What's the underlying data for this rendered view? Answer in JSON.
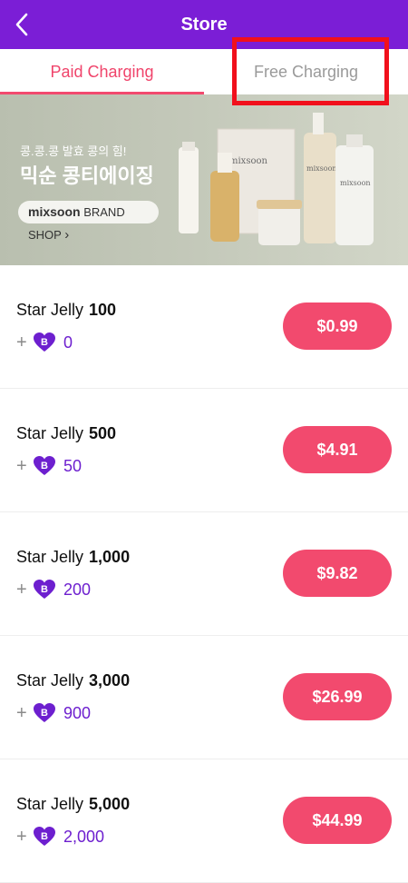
{
  "header": {
    "title": "Store"
  },
  "tabs": [
    {
      "label": "Paid Charging"
    },
    {
      "label": "Free Charging"
    }
  ],
  "banner": {
    "subtitle": "콩.콩.콩 발효 콩의 힘!",
    "title": "믹순 콩티에이징",
    "brand_button": {
      "brand": "mixsoon",
      "text": "BRAND SHOP"
    },
    "product_label": "mixsoon"
  },
  "colors": {
    "header": "#7b1ed6",
    "accent": "#f24a6e",
    "bonus": "#6d1fcf",
    "highlight": "#f1101c"
  },
  "items": [
    {
      "name": "Star Jelly",
      "amount": "100",
      "plus": "+",
      "badge": "B",
      "bonus": "0",
      "price": "$0.99"
    },
    {
      "name": "Star Jelly",
      "amount": "500",
      "plus": "+",
      "badge": "B",
      "bonus": "50",
      "price": "$4.91"
    },
    {
      "name": "Star Jelly",
      "amount": "1,000",
      "plus": "+",
      "badge": "B",
      "bonus": "200",
      "price": "$9.82"
    },
    {
      "name": "Star Jelly",
      "amount": "3,000",
      "plus": "+",
      "badge": "B",
      "bonus": "900",
      "price": "$26.99"
    },
    {
      "name": "Star Jelly",
      "amount": "5,000",
      "plus": "+",
      "badge": "B",
      "bonus": "2,000",
      "price": "$44.99"
    }
  ]
}
